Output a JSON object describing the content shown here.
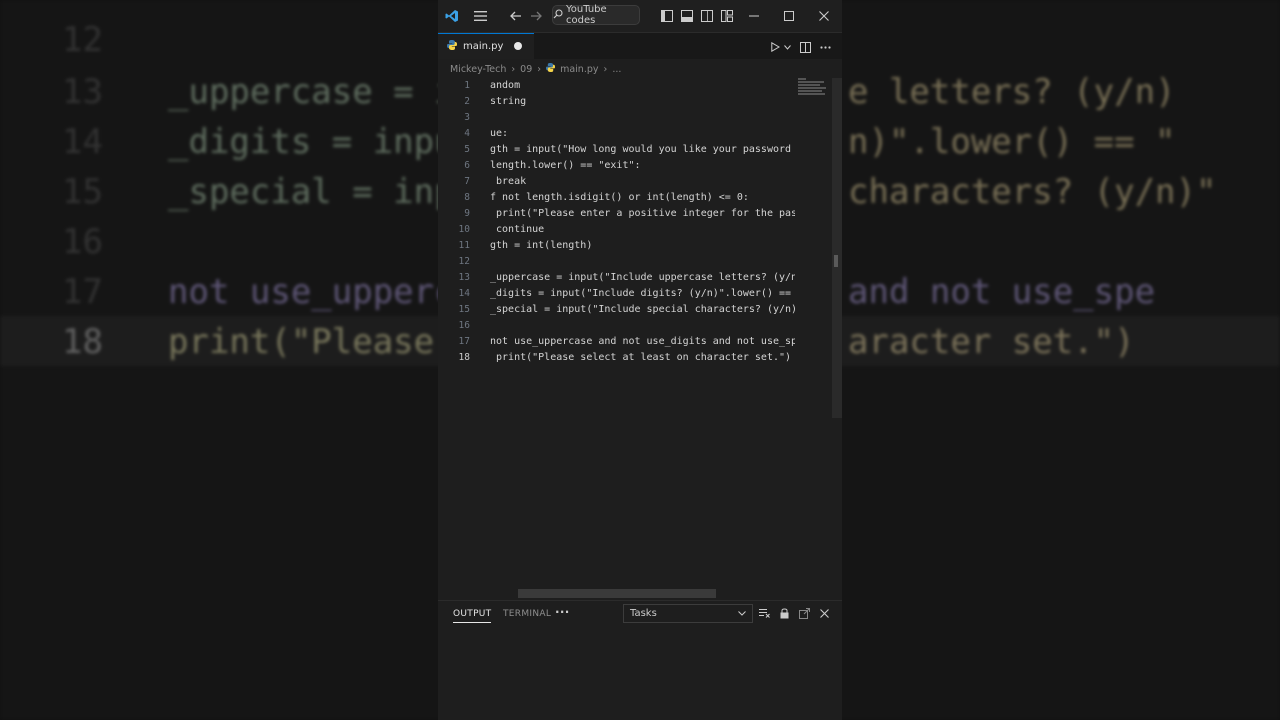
{
  "background_code": {
    "lines": [
      {
        "num": "12",
        "text": ""
      },
      {
        "num": "13",
        "text": "_uppercase = inp"
      },
      {
        "num": "14",
        "text": "_digits = input"
      },
      {
        "num": "15",
        "text": "_special = inpu"
      },
      {
        "num": "16",
        "text": ""
      },
      {
        "num": "17",
        "text": "not use_upperca"
      },
      {
        "num": "18",
        "text": "print(\"Please "
      }
    ],
    "right_fragments": [
      "e letters? (y/n)",
      "n)\".lower() == \"",
      "characters? (y/n)\"",
      "and not use_spe",
      "aracter set.\")"
    ]
  },
  "titlebar": {
    "search_label": "YouTube codes"
  },
  "tab": {
    "filename": "main.py"
  },
  "breadcrumb": {
    "parts": [
      "Mickey-Tech",
      "09",
      "main.py",
      "..."
    ]
  },
  "editor": {
    "lines": [
      {
        "num": "1",
        "text": "andom"
      },
      {
        "num": "2",
        "text": "string"
      },
      {
        "num": "3",
        "text": ""
      },
      {
        "num": "4",
        "text": "ue:"
      },
      {
        "num": "5",
        "text": "gth = input(\"How long would you like your password t"
      },
      {
        "num": "6",
        "text": "length.lower() == \"exit\":"
      },
      {
        "num": "7",
        "text": " break"
      },
      {
        "num": "8",
        "text": "f not length.isdigit() or int(length) <= 0:"
      },
      {
        "num": "9",
        "text": " print(\"Please enter a positive integer for the pass"
      },
      {
        "num": "10",
        "text": " continue"
      },
      {
        "num": "11",
        "text": "gth = int(length)"
      },
      {
        "num": "12",
        "text": ""
      },
      {
        "num": "13",
        "text": "_uppercase = input(\"Include uppercase letters? (y/n)"
      },
      {
        "num": "14",
        "text": "_digits = input(\"Include digits? (y/n)\".lower() == \""
      },
      {
        "num": "15",
        "text": "_special = input(\"Include special characters? (y/n)\""
      },
      {
        "num": "16",
        "text": ""
      },
      {
        "num": "17",
        "text": "not use_uppercase and not use_digits and not use_spe"
      },
      {
        "num": "18",
        "text": " print(\"Please select at least on character set.\")"
      }
    ],
    "current_line": "18"
  },
  "panel": {
    "tabs": [
      "OUTPUT",
      "TERMINAL"
    ],
    "active_tab": "OUTPUT",
    "more": "···",
    "select_value": "Tasks"
  },
  "colors": {
    "accent": "#0078d4",
    "editor_bg": "#1e1e1e"
  }
}
